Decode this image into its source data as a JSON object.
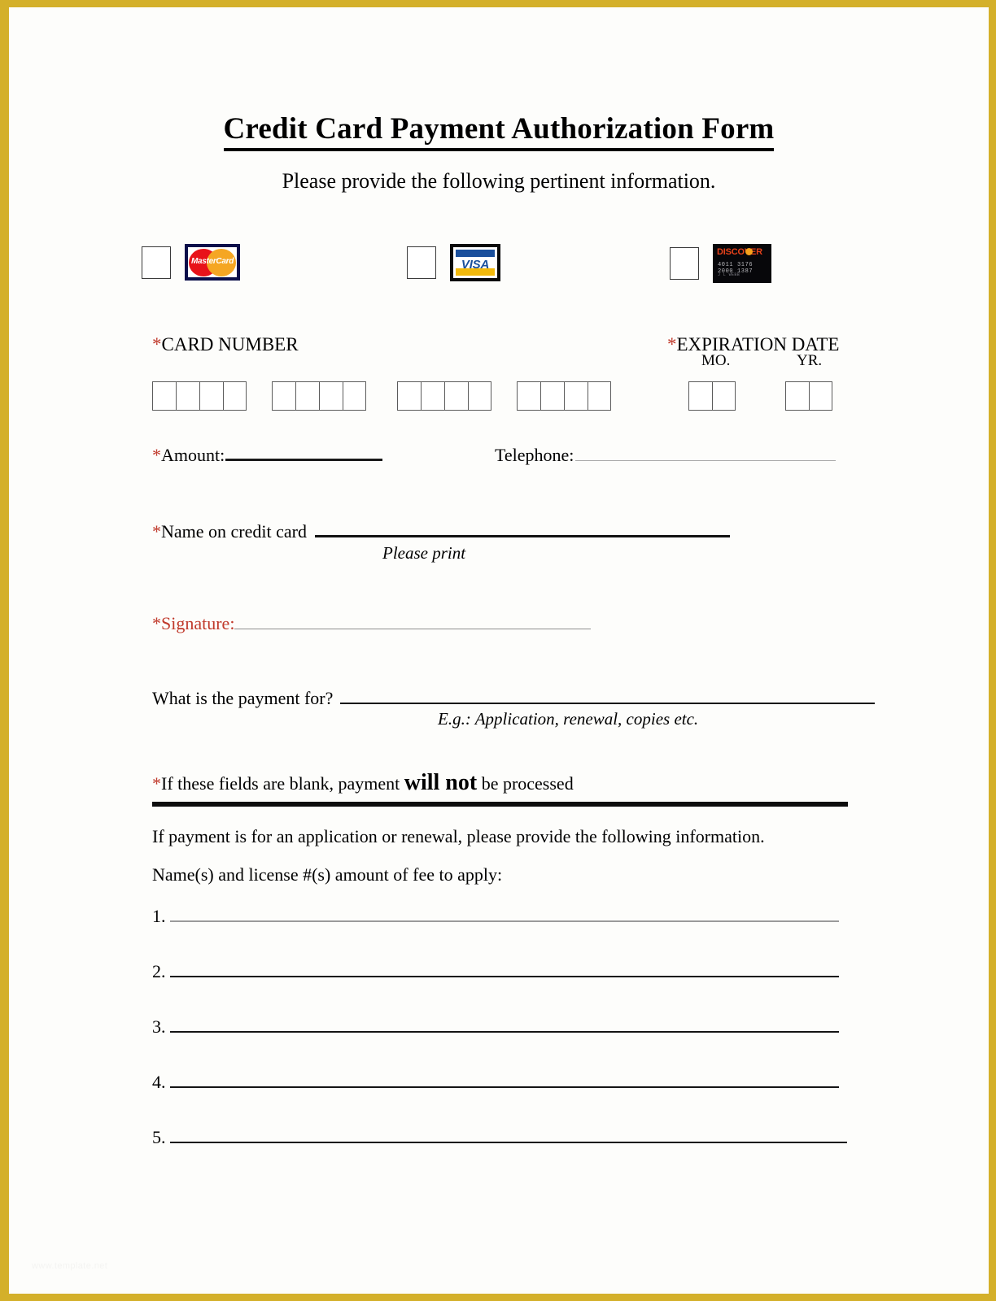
{
  "document": {
    "title": "Credit Card Payment Authorization Form",
    "subtitle": "Please provide the following pertinent information."
  },
  "card_brands": [
    {
      "name": "MasterCard",
      "logo_word": "MasterCard",
      "checkbox_label": "",
      "colors": {
        "border": "#0b0f4a",
        "left_circle": "#e8121a",
        "right_circle": "#f5a623"
      }
    },
    {
      "name": "VISA",
      "logo_word": "VISA",
      "checkbox_label": "",
      "colors": {
        "border": "#0a0a0a",
        "top_bar": "#1a4f9c",
        "bottom_bar": "#f2b90c",
        "word": "#1a4f9c"
      }
    },
    {
      "name": "DISCOVER",
      "logo_word": "DISCOVER",
      "card_number": "4011 3176 2000 1387",
      "card_name": "J L WEBB",
      "checkbox_label": "",
      "colors": {
        "background": "#07070a",
        "word": "#e8421a",
        "orb": "#f7a21b"
      }
    }
  ],
  "fields": {
    "card_number": {
      "asterisk": "*",
      "label": "CARD NUMBER",
      "groups": 4,
      "cells_per_group": 4
    },
    "expiration_date": {
      "asterisk": "*",
      "label": "EXPIRATION DATE",
      "month_label": "MO.",
      "year_label": "YR.",
      "cells_per_box": 2
    },
    "amount": {
      "asterisk": "*",
      "label": "Amount:",
      "value": ""
    },
    "telephone": {
      "label": "Telephone:",
      "value": ""
    },
    "name_on_card": {
      "asterisk": "*",
      "label": "Name on credit card",
      "value": "",
      "hint": "Please print"
    },
    "signature": {
      "asterisk": "*",
      "label": "*Signature:",
      "value": ""
    },
    "payment_for": {
      "label": "What is the payment for?",
      "value": "",
      "hint": "E.g.: Application, renewal, copies etc."
    }
  },
  "warning": {
    "asterisk": "*",
    "prefix": "If these fields are blank, payment ",
    "emphasis": "will not",
    "suffix": " be processed"
  },
  "instructions": {
    "line1": "If payment is for an application or renewal, please provide the following information.",
    "line2": "Name(s) and license #(s) amount of fee to apply:"
  },
  "numbered_lines": [
    {
      "number": "1."
    },
    {
      "number": "2."
    },
    {
      "number": "3."
    },
    {
      "number": "4."
    },
    {
      "number": "5."
    }
  ],
  "watermark": {
    "text": "www.template.net"
  },
  "colors": {
    "page_border": "#d4b02a",
    "required_asterisk": "#c0392b",
    "rule_dark": "#141414",
    "rule_light": "#9a9a9a"
  }
}
